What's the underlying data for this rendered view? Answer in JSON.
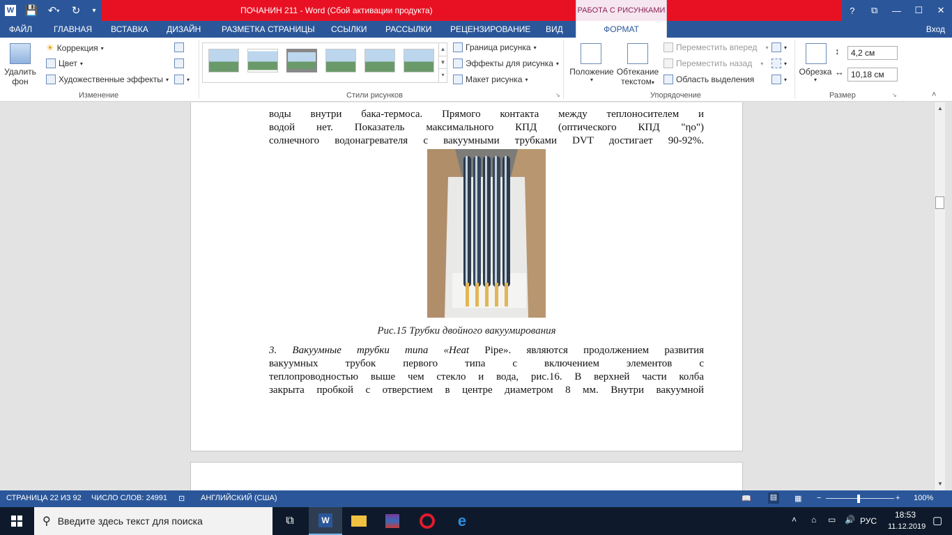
{
  "titlebar": {
    "title": "ПОЧАНИН 211 -  Word (Сбой активации продукта)",
    "context_tab": "РАБОТА С РИСУНКАМИ",
    "help": "?",
    "ribbon_display": "⧉",
    "minimize": "—",
    "maximize": "☐",
    "close": "✕"
  },
  "tabs": {
    "file": "ФАЙЛ",
    "items": [
      "ГЛАВНАЯ",
      "ВСТАВКА",
      "ДИЗАЙН",
      "РАЗМЕТКА СТРАНИЦЫ",
      "ССЫЛКИ",
      "РАССЫЛКИ",
      "РЕЦЕНЗИРОВАНИЕ",
      "ВИД"
    ],
    "format": "ФОРМАТ",
    "signin": "Вход"
  },
  "ribbon": {
    "remove_bg_line1": "Удалить",
    "remove_bg_line2": "фон",
    "correction": "Коррекция",
    "color": "Цвет",
    "art_effects": "Художественные эффекты",
    "group_adjust": "Изменение",
    "picture_border": "Граница рисунка",
    "picture_effects": "Эффекты для рисунка",
    "picture_layout": "Макет рисунка",
    "group_styles": "Стили рисунков",
    "position": "Положение",
    "wrap_line1": "Обтекание",
    "wrap_line2": "текстом",
    "bring_forward": "Переместить вперед",
    "send_backward": "Переместить назад",
    "selection_pane": "Область выделения",
    "group_arrange": "Упорядочение",
    "crop": "Обрезка",
    "height": "4,2 см",
    "width": "10,18 см",
    "group_size": "Размер"
  },
  "document": {
    "para1_lines": [
      "воды внутри бака-термоса. Прямого контакта между теплоносителем и",
      "водой нет. Показатель максимального КПД (оптического КПД \"ηо\")"
    ],
    "para1_last": "солнечного водонагревателя с вакуумными трубками DVT достигает 90-92%.",
    "caption": "Рис.15 Трубки двойного вакуумирования",
    "para2_first_italic": "3. Вакуумные трубки типа «Heat",
    "para2_first_rest": " Pipe». являются продолжением развития",
    "para2_lines": [
      "вакуумных трубок первого типа с включением элементов с",
      "теплопроводностью выше чем стекло и вода, рис.16. В верхней части колба",
      "закрыта пробкой с отверстием в центре диаметром 8 мм. Внутри вакуумной"
    ]
  },
  "statusbar": {
    "page": "СТРАНИЦА 22 ИЗ 92",
    "words": "ЧИСЛО СЛОВ: 24991",
    "language": "АНГЛИЙСКИЙ (США)",
    "zoom": "100%"
  },
  "taskbar": {
    "search_placeholder": "Введите здесь текст для поиска",
    "lang": "РУС",
    "time": "18:53",
    "date": "11.12.2019"
  }
}
